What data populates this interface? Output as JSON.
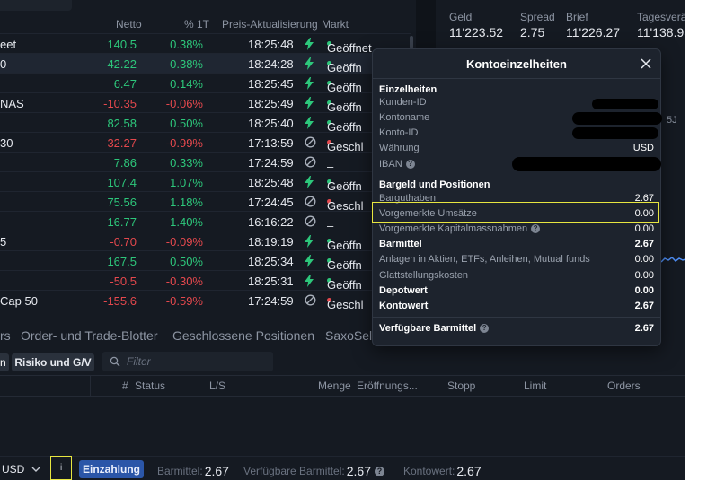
{
  "watchlist": {
    "headers": {
      "net": "Netto",
      "pct": "% 1T",
      "update": "Preis-Aktualisierung",
      "market": "Markt"
    },
    "rows": [
      {
        "name": "eet",
        "net": "140.5",
        "pct": "0.38%",
        "time": "18:25:48",
        "icon": "bolt",
        "market": "Geöffnet",
        "status": "open"
      },
      {
        "name": "0",
        "net": "42.22",
        "pct": "0.38%",
        "time": "18:24:28",
        "icon": "bolt",
        "market": "Geöffn",
        "status": "open",
        "selected": true
      },
      {
        "name": "",
        "net": "6.47",
        "pct": "0.14%",
        "time": "18:25:45",
        "icon": "bolt",
        "market": "Geöffn",
        "status": "open"
      },
      {
        "name": "NAS",
        "net": "-10.35",
        "pct": "-0.06%",
        "time": "18:25:49",
        "icon": "bolt",
        "market": "Geöffn",
        "status": "open"
      },
      {
        "name": "",
        "net": "82.58",
        "pct": "0.50%",
        "time": "18:25:40",
        "icon": "bolt",
        "market": "Geöffn",
        "status": "open"
      },
      {
        "name": "30",
        "net": "-32.27",
        "pct": "-0.99%",
        "time": "17:13:59",
        "icon": "blocked",
        "market": "Geschl",
        "status": "closed"
      },
      {
        "name": "",
        "net": "7.86",
        "pct": "0.33%",
        "time": "17:24:59",
        "icon": "blocked",
        "market": "–",
        "status": "none"
      },
      {
        "name": "",
        "net": "107.4",
        "pct": "1.07%",
        "time": "18:25:48",
        "icon": "bolt",
        "market": "Geöffn",
        "status": "open"
      },
      {
        "name": "",
        "net": "75.56",
        "pct": "1.18%",
        "time": "17:24:45",
        "icon": "blocked",
        "market": "Geschl",
        "status": "closed"
      },
      {
        "name": "",
        "net": "16.77",
        "pct": "1.40%",
        "time": "16:16:22",
        "icon": "blocked",
        "market": "–",
        "status": "none"
      },
      {
        "name": "5",
        "net": "-0.70",
        "pct": "-0.09%",
        "time": "18:19:19",
        "icon": "bolt",
        "market": "Geöffn",
        "status": "open"
      },
      {
        "name": "",
        "net": "167.5",
        "pct": "0.50%",
        "time": "18:25:34",
        "icon": "bolt",
        "market": "Geöffn",
        "status": "open"
      },
      {
        "name": "",
        "net": "-50.5",
        "pct": "-0.30%",
        "time": "18:25:31",
        "icon": "bolt",
        "market": "Geöffn",
        "status": "open"
      },
      {
        "name": "Cap 50",
        "net": "-155.6",
        "pct": "-0.59%",
        "time": "17:24:59",
        "icon": "blocked",
        "market": "Geschl",
        "status": "closed"
      }
    ]
  },
  "quote_panel": {
    "geld_label": "Geld",
    "geld_value": "11'223.52",
    "spread_label": "Spread",
    "spread_value": "2.75",
    "brief_label": "Brief",
    "brief_value": "11'226.27",
    "tages_label": "Tagesverä",
    "tages_value": "11'138.95",
    "chart_tab": "5J",
    "line_color": "#4f8ff7"
  },
  "blotter": {
    "tabs": [
      "rs",
      "Order- und Trade-Blotter",
      "Geschlossene Positionen",
      "SaxoSel"
    ],
    "subtab_a": "n",
    "subtab_b": "Risiko und G/V",
    "filter_placeholder": "Filter",
    "columns": {
      "hash": "#",
      "status": "Status",
      "ls": "L/S",
      "menge": "Menge",
      "eroeffnung": "Eröffnungs...",
      "stopp": "Stopp",
      "limit": "Limit",
      "orders": "Orders"
    }
  },
  "status_bar": {
    "currency": "USD",
    "info": "i",
    "deposit_label": "Einzahlung",
    "barmittel_label": "Barmittel:",
    "barmittel_value": "2.67",
    "verf_label": "Verfügbare Barmittel:",
    "verf_value": "2.67",
    "kontowert_label": "Kontowert:",
    "kontowert_value": "2.67",
    "highlight_color": "#e7e640"
  },
  "modal": {
    "title": "Kontoeinzelheiten",
    "sec_details": "Einzelheiten",
    "kunden_id": "Kunden-ID",
    "kontoname": "Kontoname",
    "konto_id": "Konto-ID",
    "waehrung": "Währung",
    "waehrung_value": "USD",
    "iban": "IBAN",
    "sec_cash": "Bargeld und Positionen",
    "bargut": "Barguthaben",
    "bargut_value": "2.67",
    "vorgemerkte": "Vorgemerkte Umsätze",
    "vorgemerkte_value": "0.00",
    "vorgemerkte_kap": "Vorgemerkte Kapitalmassnahmen",
    "vorgemerkte_kap_value": "0.00",
    "barmittel": "Barmittel",
    "barmittel_value": "2.67",
    "anlagen": "Anlagen in Aktien, ETFs, Anleihen, Mutual funds",
    "anlagen_value": "0.00",
    "glatt": "Glattstellungskosten",
    "glatt_value": "0.00",
    "depotwert": "Depotwert",
    "depotwert_value": "0.00",
    "kontowert": "Kontowert",
    "kontowert_value": "2.67",
    "verf": "Verfügbare Barmittel",
    "verf_value": "2.67"
  }
}
